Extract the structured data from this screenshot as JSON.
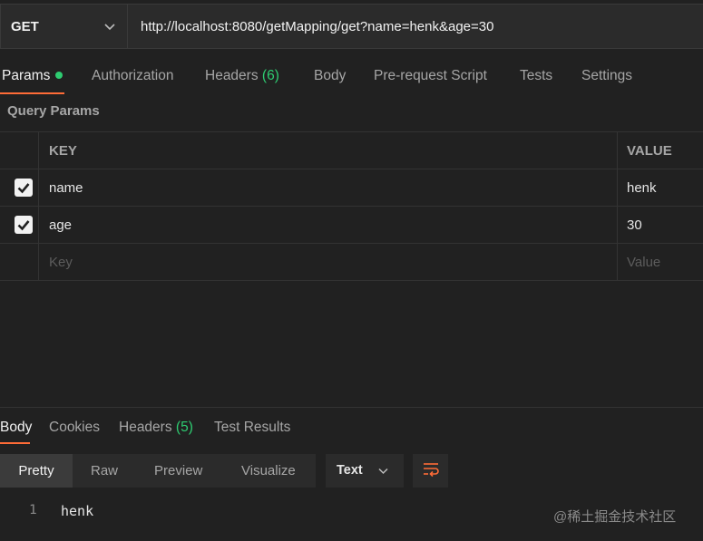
{
  "request": {
    "method": "GET",
    "url": "http://localhost:8080/getMapping/get?name=henk&age=30"
  },
  "request_tabs": [
    {
      "label": "Params",
      "active": true,
      "has_dot": true
    },
    {
      "label": "Authorization"
    },
    {
      "label": "Headers",
      "count": "(6)"
    },
    {
      "label": "Body"
    },
    {
      "label": "Pre-request Script"
    },
    {
      "label": "Tests"
    },
    {
      "label": "Settings"
    }
  ],
  "query_params": {
    "title": "Query Params",
    "headers": {
      "key": "KEY",
      "value": "VALUE"
    },
    "rows": [
      {
        "checked": true,
        "key": "name",
        "value": "henk"
      },
      {
        "checked": true,
        "key": "age",
        "value": "30"
      }
    ],
    "placeholder": {
      "key": "Key",
      "value": "Value"
    }
  },
  "response_tabs": [
    {
      "label": "Body",
      "active": true
    },
    {
      "label": "Cookies"
    },
    {
      "label": "Headers",
      "count": "(5)"
    },
    {
      "label": "Test Results"
    }
  ],
  "format_tabs": [
    "Pretty",
    "Raw",
    "Preview",
    "Visualize"
  ],
  "format_active": "Pretty",
  "language": "Text",
  "response_body": {
    "line": "1",
    "text": "henk"
  },
  "watermark": "@稀土掘金技术社区",
  "colors": {
    "accent": "#ff6c37",
    "green": "#2ecc71",
    "bg": "#212121"
  }
}
